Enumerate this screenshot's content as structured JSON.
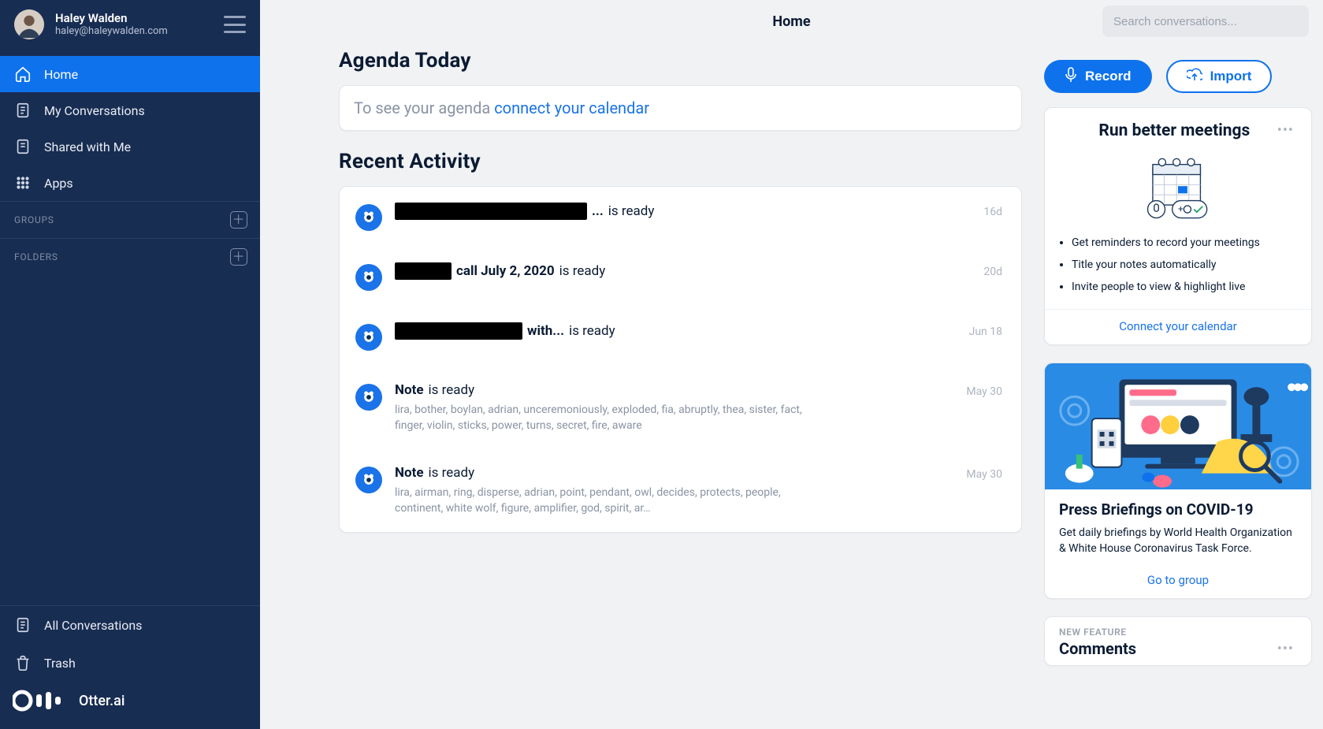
{
  "user": {
    "name": "Haley Walden",
    "email": "haley@haleywalden.com"
  },
  "header": {
    "title": "Home"
  },
  "search": {
    "placeholder": "Search conversations..."
  },
  "sidebar": {
    "nav": [
      {
        "label": "Home",
        "icon": "home",
        "active": true
      },
      {
        "label": "My Conversations",
        "icon": "doc",
        "active": false
      },
      {
        "label": "Shared with Me",
        "icon": "doc",
        "active": false
      },
      {
        "label": "Apps",
        "icon": "grid",
        "active": false
      }
    ],
    "groups_label": "GROUPS",
    "folders_label": "FOLDERS",
    "bottom": [
      {
        "label": "All Conversations",
        "icon": "doc"
      },
      {
        "label": "Trash",
        "icon": "trash"
      }
    ],
    "brand": "Otter.ai"
  },
  "agenda": {
    "heading": "Agenda Today",
    "text_prefix": "To see your agenda ",
    "link_text": "connect your calendar"
  },
  "recent": {
    "heading": "Recent Activity",
    "items": [
      {
        "redact_w": 244,
        "before": "",
        "bold_text": "...",
        "after": " is ready",
        "snippet": "",
        "date": "16d"
      },
      {
        "redact_w": 72,
        "before": "",
        "bold_text": " call July 2, 2020",
        "after": " is ready",
        "snippet": "",
        "date": "20d"
      },
      {
        "redact_w": 162,
        "before": "",
        "bold_text": " with...",
        "after": " is ready",
        "snippet": "",
        "date": "Jun 18"
      },
      {
        "redact_w": 0,
        "before": "",
        "bold_text": "Note",
        "after": " is ready",
        "snippet": "lira, bother, boylan, adrian, unceremoniously, exploded, fia, abruptly, thea, sister, fact, finger, violin, sticks, power, turns, secret, fire, aware",
        "date": "May 30"
      },
      {
        "redact_w": 0,
        "before": "",
        "bold_text": "Note",
        "after": " is ready",
        "snippet": "lira, airman, ring, disperse, adrian, point, pendant, owl, decides, protects, people, continent, white wolf, figure, amplifier, god, spirit, ar…",
        "date": "May 30"
      }
    ]
  },
  "actions": {
    "record": "Record",
    "import": "Import"
  },
  "meetings_card": {
    "title": "Run better meetings",
    "bullets": [
      "Get reminders to record your meetings",
      "Title your notes automatically",
      "Invite people to view & highlight live"
    ],
    "cta": "Connect your calendar"
  },
  "press_card": {
    "title": "Press Briefings on COVID-19",
    "body": "Get daily briefings by World Health Organization & White House Coronavirus Task Force.",
    "cta": "Go to group"
  },
  "feature_card": {
    "tag": "NEW FEATURE",
    "title": "Comments"
  }
}
